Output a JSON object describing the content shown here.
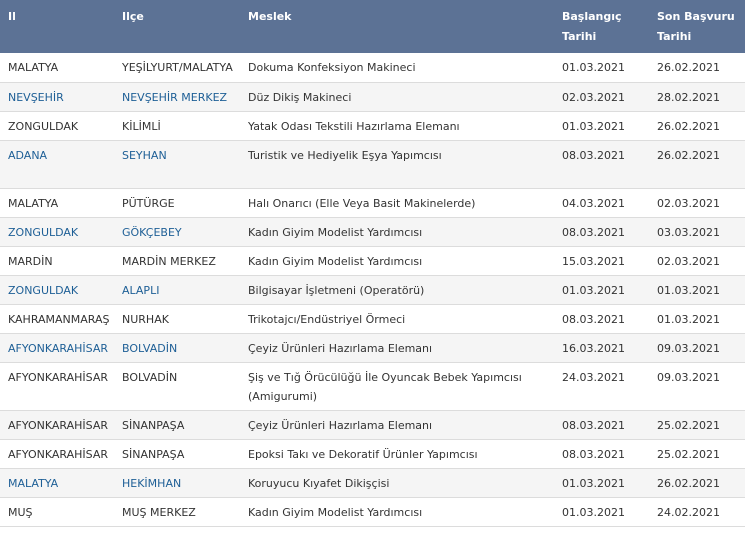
{
  "headers": {
    "il": "Il",
    "ilce": "Ilçe",
    "meslek": "Meslek",
    "baslangic": "Başlangıç Tarihi",
    "son_basvuru": "Son Başvuru Tarihi"
  },
  "rows": [
    {
      "il": "MALATYA",
      "ilce": "YEŞİLYURT/MALATYA",
      "meslek": "Dokuma Konfeksiyon Makineci",
      "baslangic": "01.03.2021",
      "son": "26.02.2021"
    },
    {
      "il": "NEVŞEHİR",
      "ilce": "NEVŞEHİR MERKEZ",
      "meslek": "Düz Dikiş Makineci",
      "baslangic": "02.03.2021",
      "son": "28.02.2021"
    },
    {
      "il": "ZONGULDAK",
      "ilce": "KİLİMLİ",
      "meslek": "Yatak Odası Tekstili Hazırlama Elemanı",
      "baslangic": "01.03.2021",
      "son": "26.02.2021"
    },
    {
      "il": "ADANA",
      "ilce": "SEYHAN",
      "meslek": "Turistik ve Hediyelik Eşya Yapımcısı",
      "baslangic": "08.03.2021",
      "son": "26.02.2021"
    },
    {
      "il": "MALATYA",
      "ilce": "PÜTÜRGE",
      "meslek": "Halı Onarıcı (Elle Veya Basit Makinelerde)",
      "baslangic": "04.03.2021",
      "son": "02.03.2021"
    },
    {
      "il": "ZONGULDAK",
      "ilce": "GÖKÇEBEY",
      "meslek": "Kadın Giyim Modelist Yardımcısı",
      "baslangic": "08.03.2021",
      "son": "03.03.2021"
    },
    {
      "il": "MARDİN",
      "ilce": "MARDİN MERKEZ",
      "meslek": "Kadın Giyim Modelist Yardımcısı",
      "baslangic": "15.03.2021",
      "son": "02.03.2021"
    },
    {
      "il": "ZONGULDAK",
      "ilce": "ALAPLI",
      "meslek": "Bilgisayar İşletmeni (Operatörü)",
      "baslangic": "01.03.2021",
      "son": "01.03.2021"
    },
    {
      "il": "KAHRAMANMARAŞ",
      "ilce": "NURHAK",
      "meslek": "Trikotajcı/Endüstriyel Örmeci",
      "baslangic": "08.03.2021",
      "son": "01.03.2021"
    },
    {
      "il": "AFYONKARAHİSAR",
      "ilce": "BOLVADİN",
      "meslek": "Çeyiz Ürünleri Hazırlama Elemanı",
      "baslangic": "16.03.2021",
      "son": "09.03.2021"
    },
    {
      "il": "AFYONKARAHİSAR",
      "ilce": "BOLVADİN",
      "meslek": "Şiş ve Tığ Örücülüğü İle Oyuncak Bebek Yapımcısı (Amigurumi)",
      "baslangic": "24.03.2021",
      "son": "09.03.2021"
    },
    {
      "il": "AFYONKARAHİSAR",
      "ilce": "SİNANPAŞA",
      "meslek": "Çeyiz Ürünleri Hazırlama Elemanı",
      "baslangic": "08.03.2021",
      "son": "25.02.2021"
    },
    {
      "il": "AFYONKARAHİSAR",
      "ilce": "SİNANPAŞA",
      "meslek": "Epoksi Takı ve Dekoratif Ürünler Yapımcısı",
      "baslangic": "08.03.2021",
      "son": "25.02.2021"
    },
    {
      "il": "MALATYA",
      "ilce": "HEKİMHAN",
      "meslek": "Koruyucu Kıyafet Dikişçisi",
      "baslangic": "01.03.2021",
      "son": "26.02.2021"
    },
    {
      "il": "MUŞ",
      "ilce": "MUŞ MERKEZ",
      "meslek": "Kadın Giyim Modelist Yardımcısı",
      "baslangic": "01.03.2021",
      "son": "24.02.2021"
    }
  ]
}
